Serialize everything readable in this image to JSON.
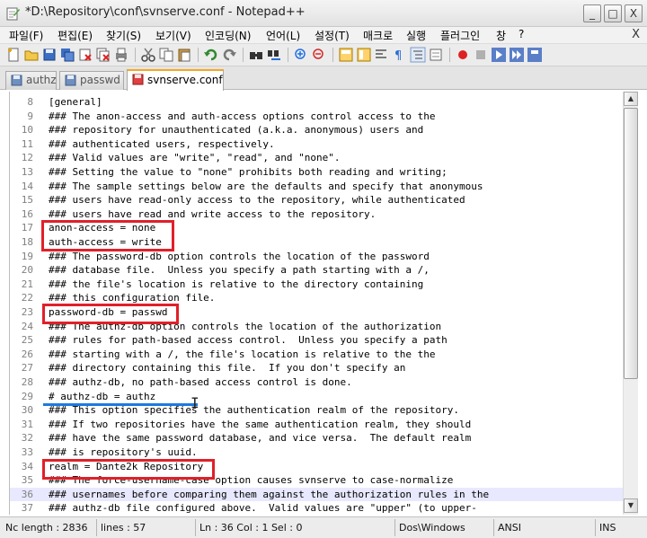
{
  "window": {
    "title": "*D:\\Repository\\conf\\svnserve.conf - Notepad++",
    "minimize": "_",
    "maximize": "□",
    "close": "X"
  },
  "menu": {
    "items": [
      "파일(F)",
      "편집(E)",
      "찾기(S)",
      "보기(V)",
      "인코딩(N)",
      "언어(L)",
      "설정(T)",
      "매크로",
      "실행",
      "플러그인",
      "창",
      "?"
    ],
    "close": "X"
  },
  "tabs": [
    {
      "label": "authz",
      "icon": "saved-file-icon"
    },
    {
      "label": "passwd",
      "icon": "saved-file-icon"
    },
    {
      "label": "svnserve.conf",
      "icon": "unsaved-file-icon",
      "active": true
    }
  ],
  "editor": {
    "current_line": 36,
    "lines": [
      {
        "num": "8",
        "text": "[general]"
      },
      {
        "num": "9",
        "text": "### The anon-access and auth-access options control access to the"
      },
      {
        "num": "10",
        "text": "### repository for unauthenticated (a.k.a. anonymous) users and"
      },
      {
        "num": "11",
        "text": "### authenticated users, respectively."
      },
      {
        "num": "12",
        "text": "### Valid values are \"write\", \"read\", and \"none\"."
      },
      {
        "num": "13",
        "text": "### Setting the value to \"none\" prohibits both reading and writing;"
      },
      {
        "num": "14",
        "text": "### The sample settings below are the defaults and specify that anonymous"
      },
      {
        "num": "15",
        "text": "### users have read-only access to the repository, while authenticated"
      },
      {
        "num": "16",
        "text": "### users have read and write access to the repository."
      },
      {
        "num": "17",
        "text": "anon-access = none"
      },
      {
        "num": "18",
        "text": "auth-access = write"
      },
      {
        "num": "19",
        "text": "### The password-db option controls the location of the password"
      },
      {
        "num": "20",
        "text": "### database file.  Unless you specify a path starting with a /,"
      },
      {
        "num": "21",
        "text": "### the file's location is relative to the directory containing"
      },
      {
        "num": "22",
        "text": "### this configuration file."
      },
      {
        "num": "23",
        "text": "password-db = passwd"
      },
      {
        "num": "24",
        "text": "### The authz-db option controls the location of the authorization"
      },
      {
        "num": "25",
        "text": "### rules for path-based access control.  Unless you specify a path"
      },
      {
        "num": "26",
        "text": "### starting with a /, the file's location is relative to the the"
      },
      {
        "num": "27",
        "text": "### directory containing this file.  If you don't specify an"
      },
      {
        "num": "28",
        "text": "### authz-db, no path-based access control is done."
      },
      {
        "num": "29",
        "text": "# authz-db = authz"
      },
      {
        "num": "30",
        "text": "### This option specifies the authentication realm of the repository."
      },
      {
        "num": "31",
        "text": "### If two repositories have the same authentication realm, they should"
      },
      {
        "num": "32",
        "text": "### have the same password database, and vice versa.  The default realm"
      },
      {
        "num": "33",
        "text": "### is repository's uuid."
      },
      {
        "num": "34",
        "text": "realm = Dante2k Repository"
      },
      {
        "num": "35",
        "text": "### The force-username-case option causes svnserve to case-normalize"
      },
      {
        "num": "36",
        "text": "### usernames before comparing them against the authorization rules in the"
      },
      {
        "num": "37",
        "text": "### authz-db file configured above.  Valid values are \"upper\" (to upper-"
      }
    ]
  },
  "statusbar": {
    "length": "Nc length : 2836",
    "lines": "lines : 57",
    "position": "Ln : 36   Col : 1   Sel : 0",
    "eol": "Dos\\Windows",
    "encoding": "ANSI",
    "mode": "INS"
  },
  "colors": {
    "highlight_box": "#e0202a",
    "underline": "#1c7ae0",
    "active_tab_accent": "#f5a623",
    "current_line": "#e8e8ff"
  }
}
